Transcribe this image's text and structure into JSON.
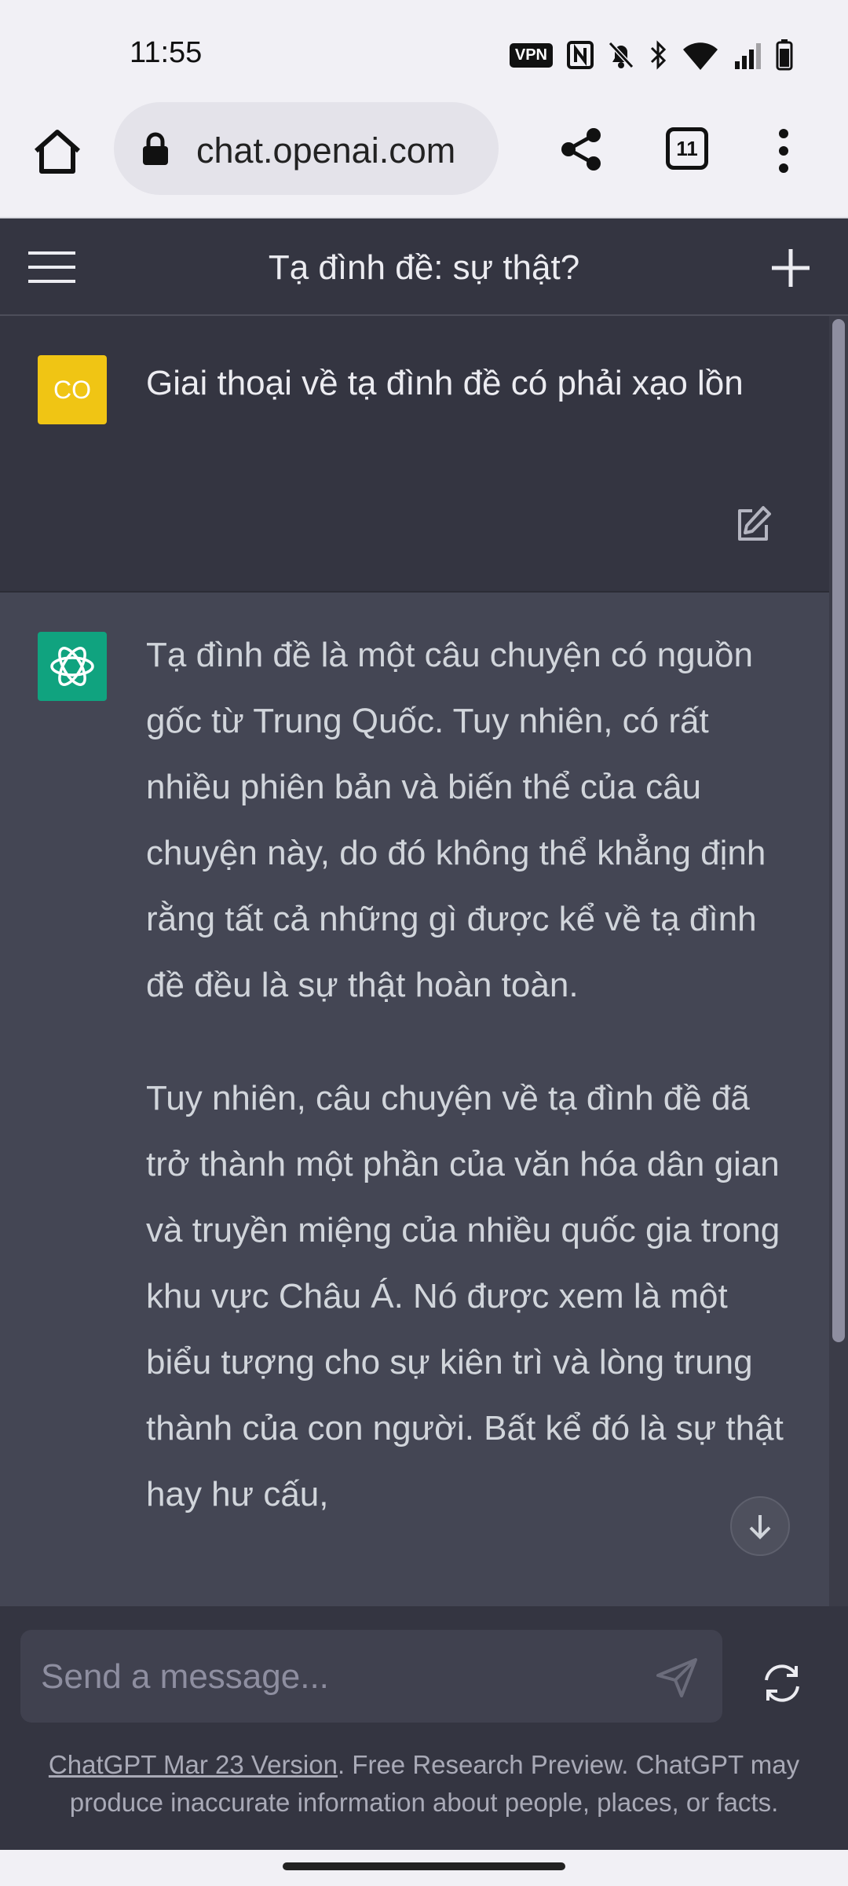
{
  "status_bar": {
    "time": "11:55",
    "vpn_label": "VPN",
    "icons": [
      "vpn-icon",
      "nfc-icon",
      "bell-off-icon",
      "bluetooth-icon",
      "wifi-icon",
      "signal-icon",
      "battery-icon"
    ]
  },
  "browser": {
    "url": "chat.openai.com",
    "tab_count": "11",
    "icons": [
      "home-icon",
      "lock-icon",
      "share-icon",
      "tabs-icon",
      "more-vert-icon"
    ]
  },
  "chat": {
    "title": "Tạ đình đề: sự thật?",
    "user_avatar_initials": "CO",
    "user_message": "Giai thoại về tạ đình đề có phải xạo lồn",
    "assistant_paragraphs": [
      "Tạ đình đề là một câu chuyện có nguồn gốc từ Trung Quốc. Tuy nhiên, có rất nhiều phiên bản và biến thể của câu chuyện này, do đó không thể khẳng định rằng tất cả những gì được kể về tạ đình đề đều là sự thật hoàn toàn.",
      "Tuy nhiên, câu chuyện về tạ đình đề đã trở thành một phần của văn hóa dân gian và truyền miệng của nhiều quốc gia trong khu vực Châu Á. Nó được xem là một biểu tượng cho sự kiên trì và lòng trung thành của con người. Bất kể đó là sự thật hay hư cấu,"
    ]
  },
  "composer": {
    "placeholder": "Send a message..."
  },
  "footer": {
    "version_link": "ChatGPT Mar 23 Version",
    "note": ". Free Research Preview. ChatGPT may produce inaccurate information about people, places, or facts."
  },
  "colors": {
    "header_bg": "#343541",
    "assistant_bg": "#444654",
    "user_avatar": "#f0c514",
    "gpt_avatar": "#10a37f"
  }
}
